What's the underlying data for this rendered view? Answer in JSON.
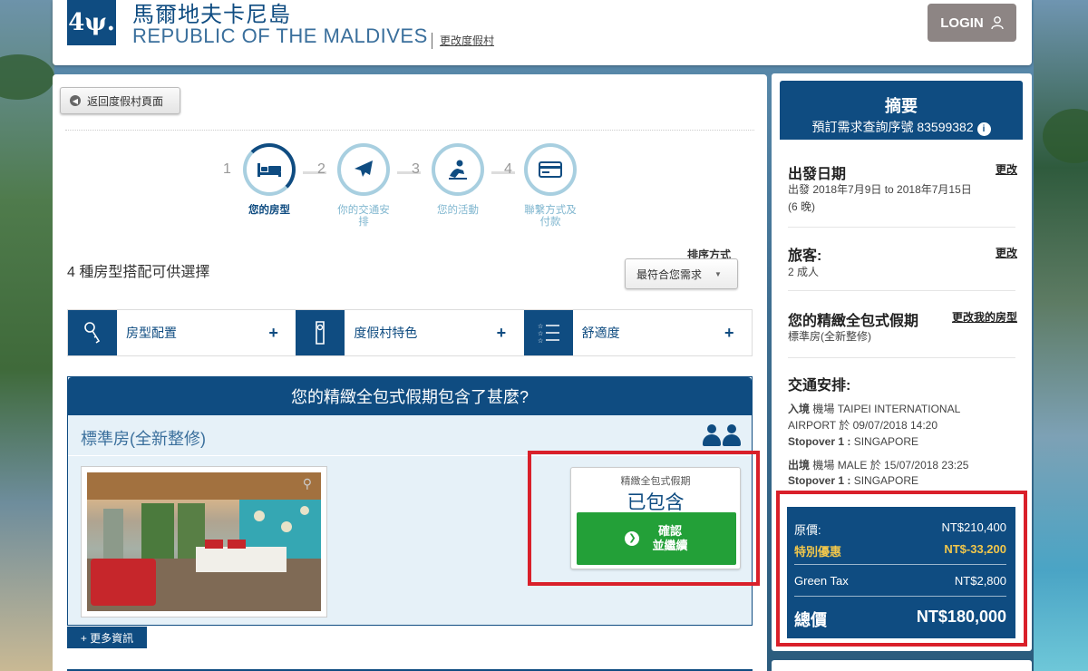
{
  "header": {
    "logo": "4ψ.",
    "title_zh": "馬爾地夫卡尼島",
    "title_en": "REPUBLIC OF THE MALDIVES",
    "change_resort": "更改度假村",
    "login_label": "LOGIN"
  },
  "main": {
    "back_label": "返回度假村頁面",
    "steps": [
      {
        "num": "1",
        "label": "您的房型",
        "icon": "bed-icon"
      },
      {
        "num": "2",
        "label": "你的交通安排",
        "icon": "airplane-icon"
      },
      {
        "num": "3",
        "label": "您的活動",
        "icon": "spa-icon"
      },
      {
        "num": "4",
        "label": "聯繫方式及付款",
        "icon": "credit-card-icon"
      }
    ],
    "room_count": "4 種房型搭配可供選擇",
    "sort_label": "排序方式",
    "sort_value": "最符合您需求",
    "filters": [
      {
        "label": "房型配置",
        "icon": "key-icon"
      },
      {
        "label": "度假村特色",
        "icon": "door-hanger-icon"
      },
      {
        "label": "舒適度",
        "icon": "star-list-icon"
      }
    ],
    "included_title": "您的精緻全包式假期包含了甚麼?",
    "room_name": "標準房(全新整修)",
    "package_label": "精緻全包式假期",
    "package_value": "已包含",
    "confirm_line1": "確認",
    "confirm_line2": "並繼續",
    "more_info": "+ 更多資訊"
  },
  "summary": {
    "title": "摘要",
    "ref_label": "預訂需求查詢序號 83599382",
    "departure_title": "出發日期",
    "departure_change": "更改",
    "departure_text": "出發 2018年7月9日 to 2018年7月15日",
    "departure_nights": "(6 晚)",
    "travelers_title": "旅客:",
    "travelers_change": "更改",
    "travelers_text": "2 成人",
    "package_title": "您的精緻全包式假期",
    "package_change": "更改我的房型",
    "package_room": "標準房(全新整修)",
    "transport_title": "交通安排:",
    "inbound_label": "入境",
    "inbound_text": "機場 TAIPEI INTERNATIONAL",
    "inbound_text2": "AIRPORT 於 09/07/2018 14:20",
    "inbound_stop_label": "Stopover 1 :",
    "inbound_stop": " SINGAPORE",
    "outbound_label": "出境",
    "outbound_text": "機場 MALE 於 15/07/2018 23:25",
    "outbound_stop_label": "Stopover 1 :",
    "outbound_stop": " SINGAPORE",
    "original_label": "原價:",
    "original_value": "NT$210,400",
    "discount_label": "特別優惠",
    "discount_value": "NT$-33,200",
    "tax_label": "Green Tax",
    "tax_value": "NT$2,800",
    "total_label": "總價",
    "total_value": "NT$180,000"
  },
  "colors": {
    "brand": "#0f4c81",
    "confirm": "#23a038",
    "highlight": "#d9202a",
    "discount": "#f2c74b"
  }
}
